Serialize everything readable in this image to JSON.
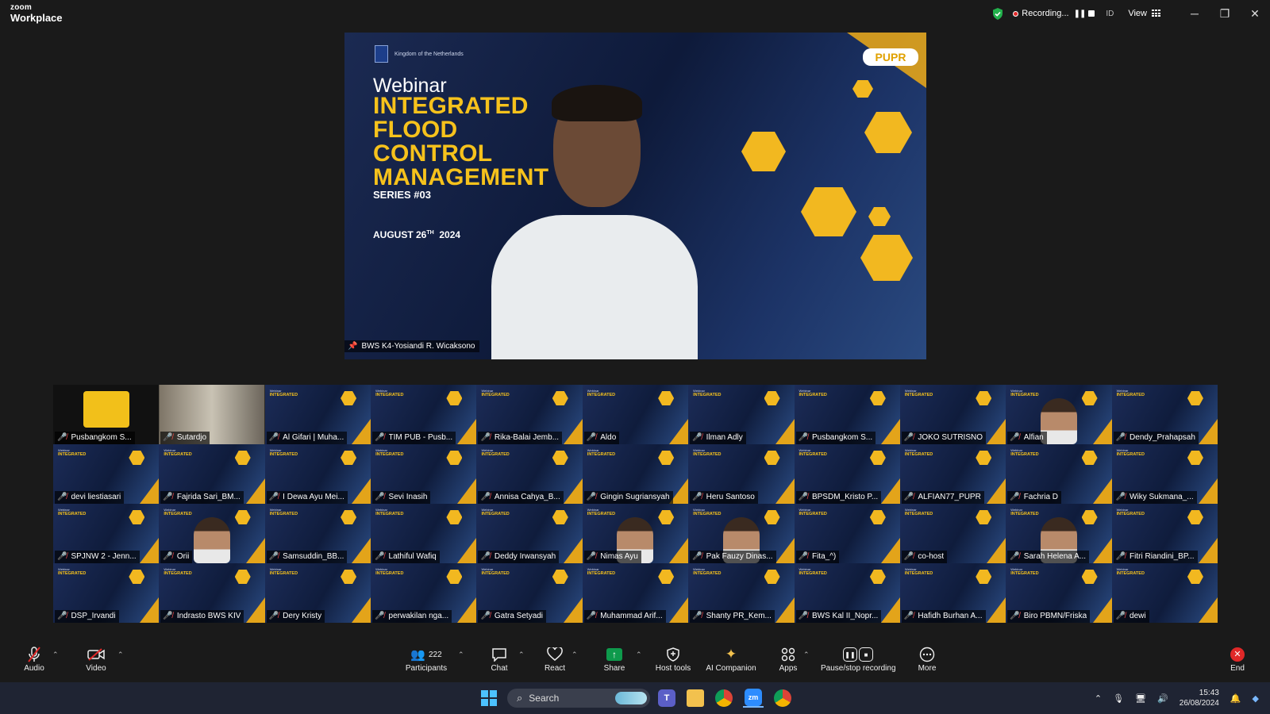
{
  "titlebar": {
    "brand_top": "zoom",
    "brand_bottom": "Workplace",
    "recording_label": "Recording...",
    "id_label": "ID",
    "view_label": "View",
    "minimize": "─",
    "restore": "❐",
    "close": "✕"
  },
  "main_video": {
    "kingdom_text": "Kingdom of the Netherlands",
    "logo_text": "PUPR",
    "webinar_label": "Webinar",
    "title_lines": [
      "INTEGRATED",
      "FLOOD",
      "CONTROL",
      "MANAGEMENT"
    ],
    "series": "SERIES #03",
    "date_main": "AUGUST 26",
    "date_sup": "TH",
    "date_year": "2024",
    "speaker_name": "BWS K4-Yosiandi R. Wicaksono"
  },
  "participants": [
    {
      "name": "Pusbangkom S...",
      "kind": "logo"
    },
    {
      "name": "Sutardjo",
      "kind": "room"
    },
    {
      "name": "Al Gifari | Muha...",
      "kind": "slide"
    },
    {
      "name": "TIM PUB - Pusb...",
      "kind": "slide"
    },
    {
      "name": "Rika-Balai Jemb...",
      "kind": "slide"
    },
    {
      "name": "Aldo",
      "kind": "slide"
    },
    {
      "name": "Ilman Adly",
      "kind": "slide"
    },
    {
      "name": "Pusbangkom S...",
      "kind": "slide"
    },
    {
      "name": "JOKO SUTRISNO",
      "kind": "slide"
    },
    {
      "name": "Alfian",
      "kind": "face"
    },
    {
      "name": "Dendy_Prahapsah",
      "kind": "slide"
    },
    {
      "name": "devi liestiasari",
      "kind": "slide"
    },
    {
      "name": "Fajrida Sari_BM...",
      "kind": "slide"
    },
    {
      "name": "I Dewa Ayu Mei...",
      "kind": "slide"
    },
    {
      "name": "Sevi Inasih",
      "kind": "slide"
    },
    {
      "name": "Annisa Cahya_B...",
      "kind": "slide"
    },
    {
      "name": "Gingin Sugriansyah",
      "kind": "slide"
    },
    {
      "name": "Heru Santoso",
      "kind": "slide"
    },
    {
      "name": "BPSDM_Kristo P...",
      "kind": "slide"
    },
    {
      "name": "ALFIAN77_PUPR",
      "kind": "slide"
    },
    {
      "name": "Fachria D",
      "kind": "slide"
    },
    {
      "name": "Wiky Sukmana_...",
      "kind": "slide"
    },
    {
      "name": "SPJNW 2 - Jenn...",
      "kind": "slide"
    },
    {
      "name": "Orii",
      "kind": "face"
    },
    {
      "name": "Samsuddin_BB...",
      "kind": "slide"
    },
    {
      "name": "Lathiful Wafiq",
      "kind": "slide"
    },
    {
      "name": "Deddy Irwansyah",
      "kind": "slide"
    },
    {
      "name": "Nimas Ayu",
      "kind": "face"
    },
    {
      "name": "Pak Fauzy Dinas...",
      "kind": "face"
    },
    {
      "name": "Fita_^)",
      "kind": "slide"
    },
    {
      "name": "co-host",
      "kind": "slide"
    },
    {
      "name": "Sarah Helena A...",
      "kind": "face"
    },
    {
      "name": "Fitri Riandini_BP...",
      "kind": "slide"
    },
    {
      "name": "DSP_Irvandi",
      "kind": "slide"
    },
    {
      "name": "Indrasto BWS KIV",
      "kind": "slide"
    },
    {
      "name": "Dery Kristy",
      "kind": "slide"
    },
    {
      "name": "perwakilan nga...",
      "kind": "slide"
    },
    {
      "name": "Gatra Setyadi",
      "kind": "slide"
    },
    {
      "name": "Muhammad Arif...",
      "kind": "slide"
    },
    {
      "name": "Shanty PR_Kem...",
      "kind": "slide"
    },
    {
      "name": "BWS Kal II_Nopr...",
      "kind": "slide"
    },
    {
      "name": "Hafidh Burhan A...",
      "kind": "slide"
    },
    {
      "name": "Biro PBMN/Friska",
      "kind": "slide"
    },
    {
      "name": "dewi",
      "kind": "slide"
    }
  ],
  "toolbar": {
    "audio": "Audio",
    "video": "Video",
    "participants": "Participants",
    "participants_count": "222",
    "chat": "Chat",
    "react": "React",
    "share": "Share",
    "host_tools": "Host tools",
    "ai_companion": "AI Companion",
    "apps": "Apps",
    "pause_recording": "Pause/stop recording",
    "more": "More",
    "end": "End"
  },
  "taskbar": {
    "search_placeholder": "Search",
    "time": "15:43",
    "date": "26/08/2024"
  },
  "colors": {
    "accent_gold": "#f6c21c",
    "record_red": "#e02828",
    "share_green": "#0e9a4c",
    "slide_navy": "#1b2a52"
  }
}
